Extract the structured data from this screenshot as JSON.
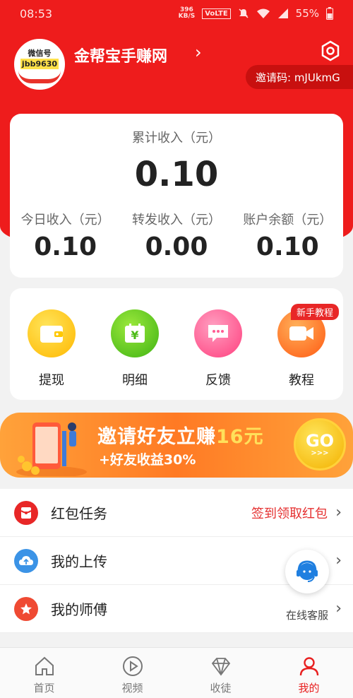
{
  "status_bar": {
    "time": "08:53",
    "speed_value": "396",
    "speed_unit": "KB/S",
    "volte": "VoLTE",
    "battery": "55%"
  },
  "profile": {
    "avatar_line1": "微信号",
    "avatar_line2": "jbb9630",
    "shop_name": "金帮宝手赚网",
    "invite_code": "邀请码: mJUkmG"
  },
  "income": {
    "total_label": "累计收入（元）",
    "total_value": "0.10",
    "today_label": "今日收入（元）",
    "today_value": "0.10",
    "share_label": "转发收入（元）",
    "share_value": "0.00",
    "balance_label": "账户余额（元）",
    "balance_value": "0.10"
  },
  "actions": [
    {
      "label": "提现",
      "color": "#ffc800"
    },
    {
      "label": "明细",
      "color": "#63c81a"
    },
    {
      "label": "反馈",
      "color": "#ff5d93"
    },
    {
      "label": "教程",
      "color": "#ff7a1f",
      "badge": "新手教程"
    }
  ],
  "banner": {
    "title_pre": "邀请好友立赚",
    "title_amount": "16元",
    "subtitle": "+好友收益30%",
    "go": "GO",
    "go_arrows": ">>>"
  },
  "list": [
    {
      "label": "红包任务",
      "right": "签到领取红包",
      "icon": "red-envelope-icon",
      "color": "#e82727"
    },
    {
      "label": "我的上传",
      "right": "",
      "icon": "cloud-upload-icon",
      "color": "#3b93e6"
    },
    {
      "label": "我的师傅",
      "right": "",
      "icon": "star-icon",
      "color": "#ef4a33"
    }
  ],
  "customer_service": {
    "label": "在线客服"
  },
  "tabs": [
    {
      "label": "首页",
      "icon": "home-icon"
    },
    {
      "label": "视频",
      "icon": "play-icon"
    },
    {
      "label": "收徒",
      "icon": "diamond-icon"
    },
    {
      "label": "我的",
      "icon": "person-icon",
      "active": true
    }
  ]
}
